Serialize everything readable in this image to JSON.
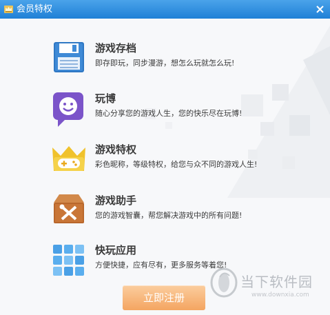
{
  "window": {
    "title": "会员特权",
    "app_icon": "crown-icon",
    "close_icon": "close-icon"
  },
  "features": [
    {
      "name": "游戏存档",
      "desc": "即存即玩，同步漫游，想怎么玩就怎么玩!",
      "icon": "floppy-disk-icon"
    },
    {
      "name": "玩博",
      "desc": "随心分享您的游戏人生，您的快乐尽在玩博!",
      "icon": "smiley-chat-icon"
    },
    {
      "name": "游戏特权",
      "desc": "彩色昵称，等级特权，给您与众不同的游戏人生!",
      "icon": "gamepad-crown-icon"
    },
    {
      "name": "游戏助手",
      "desc": "您的游戏智囊，帮您解决游戏中的所有问题!",
      "icon": "toolbox-icon"
    },
    {
      "name": "快玩应用",
      "desc": "方便快捷，应有尽有，更多服务等着您!",
      "icon": "app-grid-icon"
    }
  ],
  "register_button": "立即注册",
  "watermark": {
    "name": "当下软件园",
    "url": "www.downxia.com"
  },
  "colors": {
    "title_bar": "#2b8be0",
    "button": "#f4a561"
  }
}
